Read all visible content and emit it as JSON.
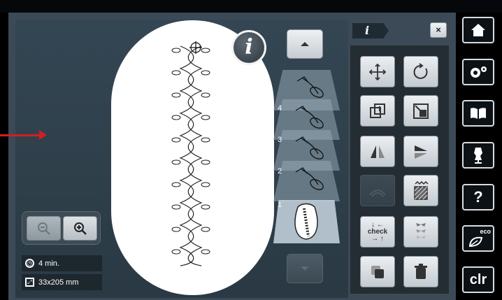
{
  "canvas": {
    "info_button_label": "i",
    "layer_numbers": [
      "4",
      "3",
      "2",
      "1"
    ]
  },
  "status": {
    "time": "4 min.",
    "size": "33x205 mm"
  },
  "tools_panel": {
    "tab_label": "i",
    "close_label": "×",
    "check_label": "check"
  },
  "sidebar": {
    "help_label": "?",
    "eco_label": "eco",
    "clr_label": "clr"
  },
  "colors": {
    "frame": "#3b4a56",
    "hoop": "#ffffff",
    "arrow": "#d21f1f"
  }
}
